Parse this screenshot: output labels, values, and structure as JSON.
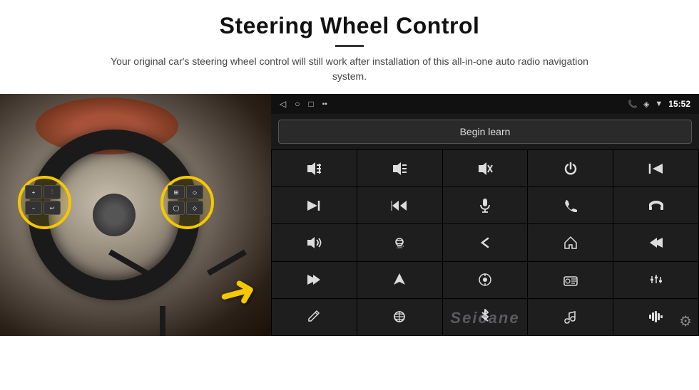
{
  "header": {
    "title": "Steering Wheel Control",
    "divider": true,
    "subtitle": "Your original car's steering wheel control will still work after installation of this all-in-one auto radio navigation system."
  },
  "android_screen": {
    "status_bar": {
      "nav_back": "◁",
      "nav_home": "○",
      "nav_recent": "□",
      "battery_signal": "▪▪",
      "phone_icon": "📞",
      "location_icon": "◈",
      "wifi_icon": "▼",
      "time": "15:52"
    },
    "begin_learn_label": "Begin learn",
    "watermark": "Seicane",
    "settings_icon": "⚙"
  },
  "controls": {
    "rows": [
      [
        "vol_up",
        "vol_down",
        "mute",
        "power",
        "prev_track"
      ],
      [
        "skip_next",
        "skip_prev_fast",
        "mic",
        "phone",
        "hang_up"
      ],
      [
        "speaker",
        "360_cam",
        "back",
        "home",
        "skip_back"
      ],
      [
        "skip_forward",
        "nav",
        "source",
        "radio",
        "eq"
      ],
      [
        "pen",
        "menu",
        "bluetooth",
        "music",
        "waves"
      ]
    ]
  }
}
